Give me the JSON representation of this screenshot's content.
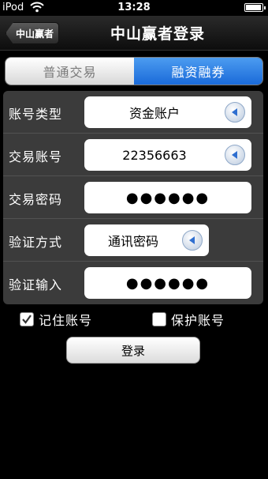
{
  "status_bar": {
    "carrier": "iPod",
    "time": "13:28"
  },
  "nav": {
    "back_label": "中山赢者",
    "title": "中山赢者登录"
  },
  "tabs": [
    {
      "label": "普通交易",
      "active": false
    },
    {
      "label": "融资融券",
      "active": true
    }
  ],
  "form": {
    "account_type": {
      "label": "账号类型",
      "value": "资金账户"
    },
    "trade_account": {
      "label": "交易账号",
      "value": "22356663"
    },
    "trade_password": {
      "label": "交易密码",
      "value": "●●●●●●"
    },
    "verify_method": {
      "label": "验证方式",
      "value": "通讯密码"
    },
    "verify_input": {
      "label": "验证输入",
      "value": "●●●●●●"
    }
  },
  "options": {
    "remember_account": {
      "label": "记住账号",
      "checked": true
    },
    "protect_account": {
      "label": "保护账号",
      "checked": false
    }
  },
  "login_label": "登录",
  "colors": {
    "accent": "#1a6ad9",
    "arrow": "#2f6fd0",
    "panel": "#3b3b3b"
  }
}
